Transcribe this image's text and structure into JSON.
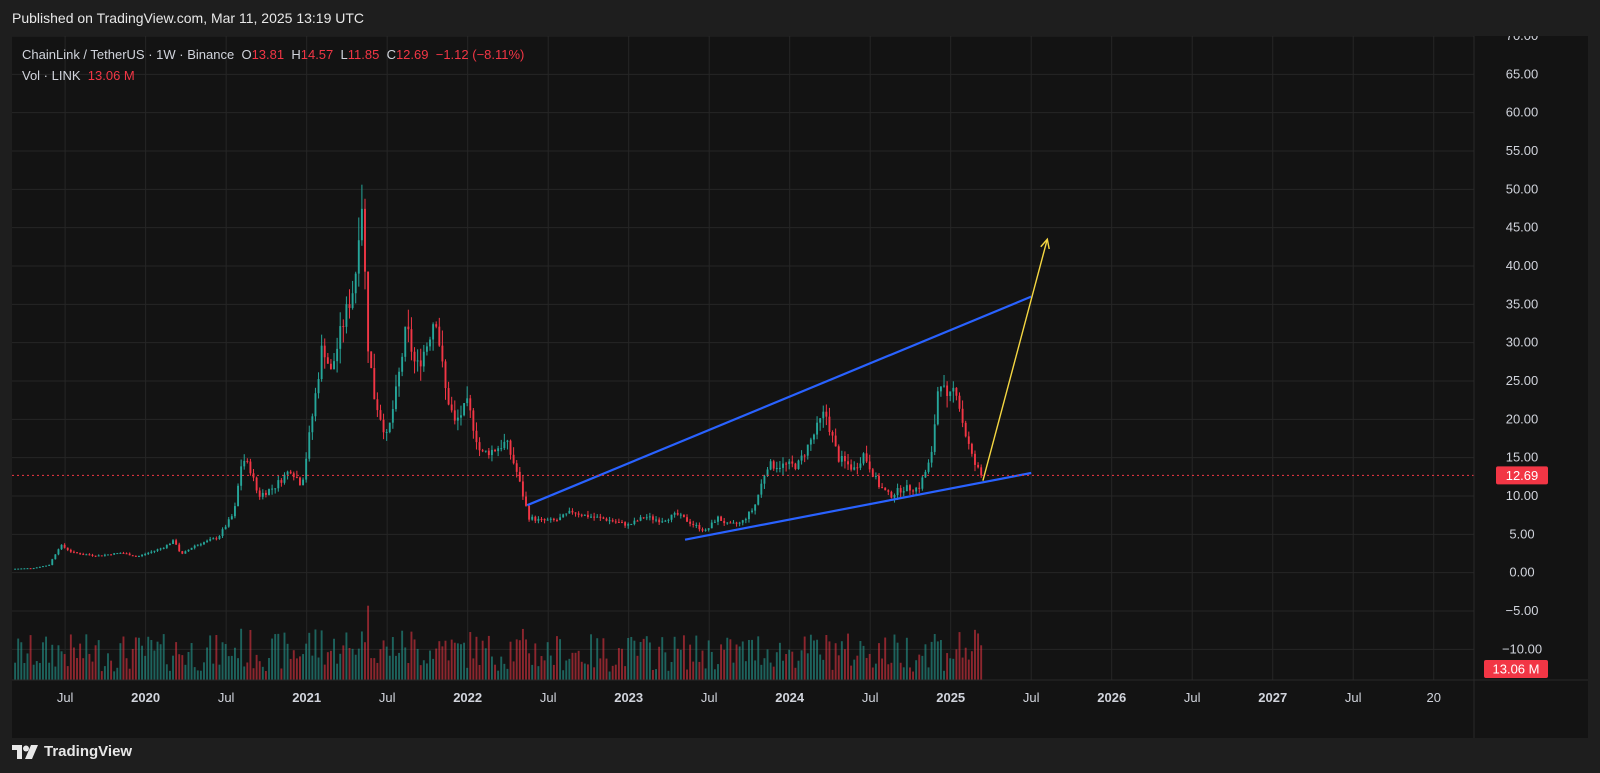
{
  "header": {
    "published": "Published on TradingView.com, Mar 11, 2025 13:19 UTC"
  },
  "footer": {
    "brand": "TradingView",
    "logo_icon": "tradingview-logo-icon"
  },
  "legend": {
    "symbol": "ChainLink / TetherUS · 1W · Binance",
    "o_label": "O",
    "o_value": "13.81",
    "h_label": "H",
    "h_value": "14.57",
    "l_label": "L",
    "l_value": "11.85",
    "c_label": "C",
    "c_value": "12.69",
    "change": "−1.12 (−8.11%)",
    "vol_label": "Vol · LINK",
    "vol_value": "13.06 M"
  },
  "colors": {
    "up": "#26a69a",
    "down": "#f23645",
    "trendline": "#2962ff",
    "arrow": "#f5d742",
    "background": "#131313",
    "grid": "#262626",
    "axis_text": "#d1d4dc"
  },
  "chart_data": {
    "type": "candlestick",
    "ylim": [
      -14,
      70
    ],
    "y_ticks": [
      "70.00",
      "65.00",
      "60.00",
      "55.00",
      "50.00",
      "45.00",
      "40.00",
      "35.00",
      "30.00",
      "25.00",
      "20.00",
      "15.00",
      "10.00",
      "5.00",
      "0.00",
      "−5.00",
      "−10.00"
    ],
    "y_tick_values": [
      70,
      65,
      60,
      55,
      50,
      45,
      40,
      35,
      30,
      25,
      20,
      15,
      10,
      5,
      0,
      -5,
      -10
    ],
    "x_ticks": [
      {
        "label": "Jul",
        "t": 2019.5
      },
      {
        "label": "2020",
        "t": 2020.0
      },
      {
        "label": "Jul",
        "t": 2020.5
      },
      {
        "label": "2021",
        "t": 2021.0
      },
      {
        "label": "Jul",
        "t": 2021.5
      },
      {
        "label": "2022",
        "t": 2022.0
      },
      {
        "label": "Jul",
        "t": 2022.5
      },
      {
        "label": "2023",
        "t": 2023.0
      },
      {
        "label": "Jul",
        "t": 2023.5
      },
      {
        "label": "2024",
        "t": 2024.0
      },
      {
        "label": "Jul",
        "t": 2024.5
      },
      {
        "label": "2025",
        "t": 2025.0
      },
      {
        "label": "Jul",
        "t": 2025.5
      },
      {
        "label": "2026",
        "t": 2026.0
      },
      {
        "label": "Jul",
        "t": 2026.5
      },
      {
        "label": "2027",
        "t": 2027.0
      },
      {
        "label": "Jul",
        "t": 2027.5
      },
      {
        "label": "20",
        "t": 2028.0
      }
    ],
    "x_range": [
      2019.17,
      2028.25
    ],
    "last_price": 12.69,
    "last_price_label": "12.69",
    "last_volume_label": "13.06 M",
    "price_anchors": [
      [
        2019.17,
        0.5
      ],
      [
        2019.3,
        0.6
      ],
      [
        2019.4,
        1.0
      ],
      [
        2019.47,
        3.6
      ],
      [
        2019.55,
        2.6
      ],
      [
        2019.7,
        2.2
      ],
      [
        2019.85,
        2.6
      ],
      [
        2019.95,
        2.1
      ],
      [
        2020.1,
        3.2
      ],
      [
        2020.18,
        4.2
      ],
      [
        2020.22,
        2.3
      ],
      [
        2020.3,
        3.5
      ],
      [
        2020.45,
        4.6
      ],
      [
        2020.55,
        7.8
      ],
      [
        2020.6,
        15.0
      ],
      [
        2020.65,
        13.5
      ],
      [
        2020.7,
        10.0
      ],
      [
        2020.8,
        11.2
      ],
      [
        2020.9,
        13.5
      ],
      [
        2020.97,
        11.5
      ],
      [
        2021.0,
        15.5
      ],
      [
        2021.05,
        22.5
      ],
      [
        2021.1,
        30.0
      ],
      [
        2021.15,
        26.0
      ],
      [
        2021.22,
        32.0
      ],
      [
        2021.3,
        38.0
      ],
      [
        2021.34,
        50.0
      ],
      [
        2021.38,
        30.0
      ],
      [
        2021.42,
        23.0
      ],
      [
        2021.5,
        17.5
      ],
      [
        2021.56,
        24.0
      ],
      [
        2021.62,
        32.0
      ],
      [
        2021.68,
        26.5
      ],
      [
        2021.75,
        30.0
      ],
      [
        2021.8,
        34.0
      ],
      [
        2021.86,
        24.0
      ],
      [
        2021.92,
        19.5
      ],
      [
        2022.0,
        22.0
      ],
      [
        2022.08,
        15.5
      ],
      [
        2022.16,
        16.0
      ],
      [
        2022.24,
        17.0
      ],
      [
        2022.3,
        13.5
      ],
      [
        2022.38,
        7.2
      ],
      [
        2022.45,
        6.8
      ],
      [
        2022.55,
        6.8
      ],
      [
        2022.65,
        8.0
      ],
      [
        2022.72,
        7.5
      ],
      [
        2022.85,
        7.0
      ],
      [
        2023.0,
        6.2
      ],
      [
        2023.1,
        7.3
      ],
      [
        2023.2,
        6.8
      ],
      [
        2023.3,
        7.6
      ],
      [
        2023.4,
        6.3
      ],
      [
        2023.48,
        5.4
      ],
      [
        2023.55,
        7.2
      ],
      [
        2023.62,
        6.2
      ],
      [
        2023.7,
        6.5
      ],
      [
        2023.78,
        8.5
      ],
      [
        2023.86,
        14.0
      ],
      [
        2023.95,
        14.0
      ],
      [
        2024.05,
        14.0
      ],
      [
        2024.15,
        18.0
      ],
      [
        2024.22,
        21.0
      ],
      [
        2024.3,
        15.0
      ],
      [
        2024.4,
        13.5
      ],
      [
        2024.46,
        15.5
      ],
      [
        2024.55,
        11.5
      ],
      [
        2024.62,
        10.0
      ],
      [
        2024.7,
        11.0
      ],
      [
        2024.8,
        11.0
      ],
      [
        2024.88,
        15.0
      ],
      [
        2024.93,
        26.0
      ],
      [
        2024.98,
        22.0
      ],
      [
        2025.03,
        24.5
      ],
      [
        2025.08,
        19.0
      ],
      [
        2025.14,
        14.5
      ],
      [
        2025.19,
        12.69
      ]
    ],
    "annotations": [
      {
        "type": "trendline",
        "label": "upper",
        "from": [
          2022.37,
          8.8
        ],
        "to": [
          2025.5,
          36.0
        ]
      },
      {
        "type": "trendline",
        "label": "lower",
        "from": [
          2023.35,
          4.3
        ],
        "to": [
          2025.5,
          13.0
        ]
      },
      {
        "type": "arrow",
        "from": [
          2025.2,
          12.0
        ],
        "to": [
          2025.6,
          43.5
        ]
      }
    ]
  }
}
